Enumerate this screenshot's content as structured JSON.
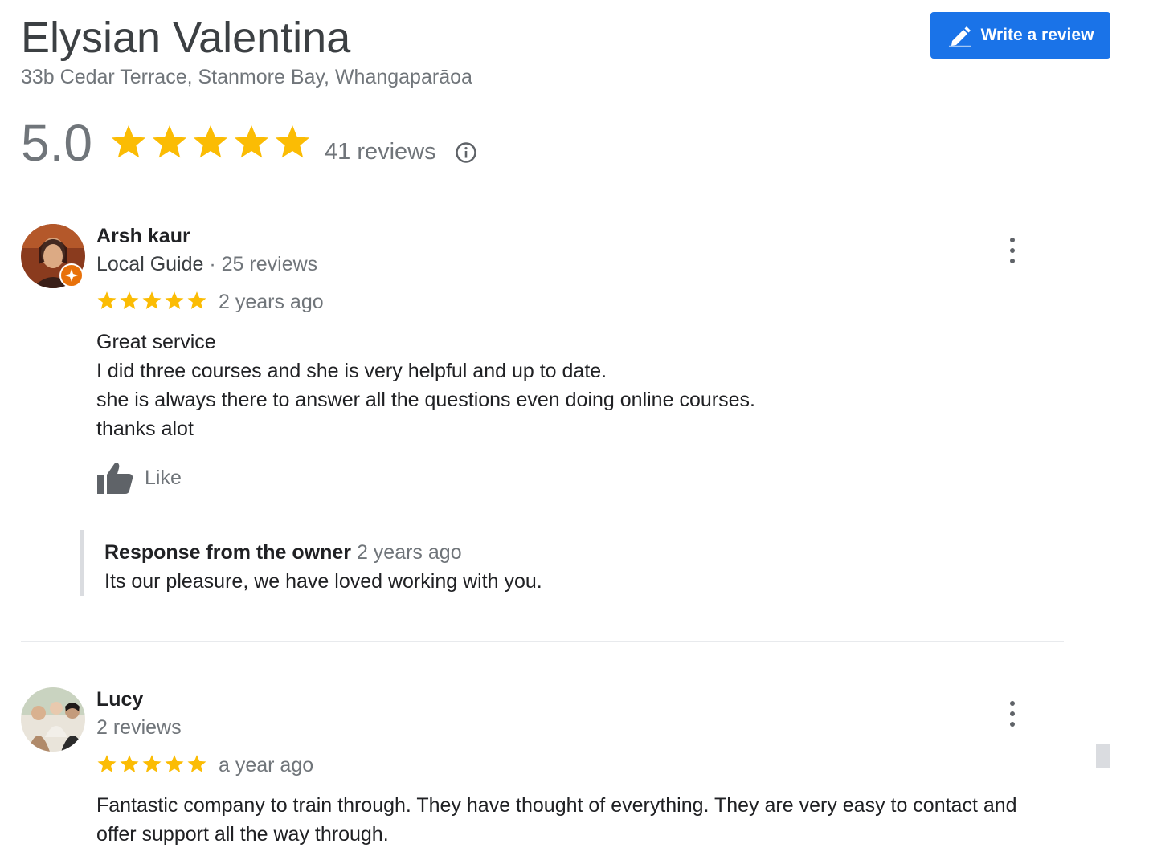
{
  "place": {
    "name": "Elysian Valentina",
    "address": "33b Cedar Terrace, Stanmore Bay, Whangaparāoa"
  },
  "write_review": {
    "label": "Write a review",
    "icon": "pencil-icon"
  },
  "rating_summary": {
    "score": "5.0",
    "stars": 5,
    "total": "41 reviews",
    "info_icon": "info-icon"
  },
  "colors": {
    "star": "#fbbc04",
    "primary": "#1a73e8",
    "muted": "#70757a",
    "text": "#202124"
  },
  "reviews": [
    {
      "author": "Arsh kaur",
      "guide_label": "Local Guide",
      "separator": " · ",
      "review_count": "25 reviews",
      "stars": 5,
      "time": "2 years ago",
      "lines": [
        "Great service",
        "I did three courses and she is very helpful and up to date.",
        "she is always there to answer all the questions even doing online courses.",
        "thanks alot"
      ],
      "like_label": "Like",
      "owner_response": {
        "label": "Response from the owner",
        "time": "2 years ago",
        "text": "Its our pleasure, we have loved working with you."
      }
    },
    {
      "author": "Lucy",
      "review_count": "2 reviews",
      "stars": 5,
      "time": "a year ago",
      "lines": [
        "Fantastic company to train through. They have thought of everything. They are very easy to contact and",
        "offer support all the way through."
      ]
    }
  ]
}
